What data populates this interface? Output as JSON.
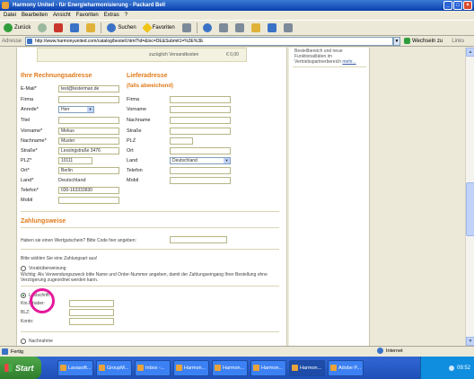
{
  "window": {
    "title": "Harmony United - für Energieharmonisierung - Packard Bell",
    "controls": [
      "_",
      "□",
      "×"
    ]
  },
  "menu": [
    "Datei",
    "Bearbeiten",
    "Ansicht",
    "Favoriten",
    "Extras",
    "?"
  ],
  "toolbar": {
    "back_label": "Zurück",
    "search_label": "Suchen",
    "favorites_label": "Favoriten"
  },
  "addressbar": {
    "label": "Adresse",
    "url": "http://www.harmonyunited.com/catalog/bestell.html?id=&loc=DE&Submit1=%3E%3E",
    "go_label": "Wechseln zu",
    "links_label": "Links"
  },
  "sidebar": {
    "text": "Bestellbereich und neue Funktionalitäten im Vertriebspartnerbereich",
    "more_link": "mehr..."
  },
  "shipping": {
    "label": "zuzüglich Versandkosten",
    "value": "€ 0,00"
  },
  "billing": {
    "title": "Ihre Rechnungsadresse",
    "fields": [
      {
        "label": "E-Mail*",
        "value": "test@testerman.de"
      },
      {
        "label": "Firma",
        "value": ""
      },
      {
        "label": "Anrede*",
        "value": "Herr"
      },
      {
        "label": "Titel",
        "value": ""
      },
      {
        "label": "Vorname*",
        "value": "Mekus"
      },
      {
        "label": "Nachname*",
        "value": "Muster"
      },
      {
        "label": "Straße*",
        "value": "Lessingstraße 3476"
      },
      {
        "label": "PLZ*",
        "value": "10111"
      },
      {
        "label": "Ort*",
        "value": "Berlin"
      },
      {
        "label": "Land*",
        "value": "Deutschland"
      },
      {
        "label": "Telefon*",
        "value": "030-163333830"
      },
      {
        "label": "Mobil",
        "value": ""
      }
    ]
  },
  "delivery": {
    "title": "Lieferadresse",
    "subtitle": "(falls abweichend)",
    "fields": [
      {
        "label": "Firma",
        "value": ""
      },
      {
        "label": "Vorname",
        "value": ""
      },
      {
        "label": "Nachname",
        "value": ""
      },
      {
        "label": "Straße",
        "value": ""
      },
      {
        "label": "PLZ",
        "value": ""
      },
      {
        "label": "Ort",
        "value": ""
      },
      {
        "label": "Land",
        "value": "Deutschland"
      },
      {
        "label": "Telefon",
        "value": ""
      },
      {
        "label": "Mobil",
        "value": ""
      }
    ]
  },
  "payment": {
    "title": "Zahlungsweise",
    "voucher_text": "Haben sie einen Wertgutschein? Bitte Code hier angeben:",
    "choose_text": "Bitte wählen Sie eine Zahlungsart aus!",
    "prepay_label": "Vorabüberweisung",
    "prepay_note": "Wichtig: Als Verwendungszweck bitte Name und Order-Nummer angeben, damit der Zahlungseingang Ihrer Bestellung ohne Verzögerung zugeordnet werden kann.",
    "debit_label": "Lastschrift",
    "debit_fields": [
      "Kto.Inhaber:",
      "BLZ:",
      "Konto:"
    ],
    "cod_label": "Nachnahme"
  },
  "status": {
    "text": "Fertig",
    "zone": "Internet"
  },
  "taskbar": {
    "start_label": "Start",
    "tasks": [
      "Lavasoft...",
      "GroupM...",
      "Inbox -...",
      "Harmon...",
      "Harmon...",
      "Harmon...",
      "Harmon...",
      "Harmon...",
      "Harmon...",
      "Adobe P...",
      "Desktop"
    ],
    "clock": "09:52"
  }
}
